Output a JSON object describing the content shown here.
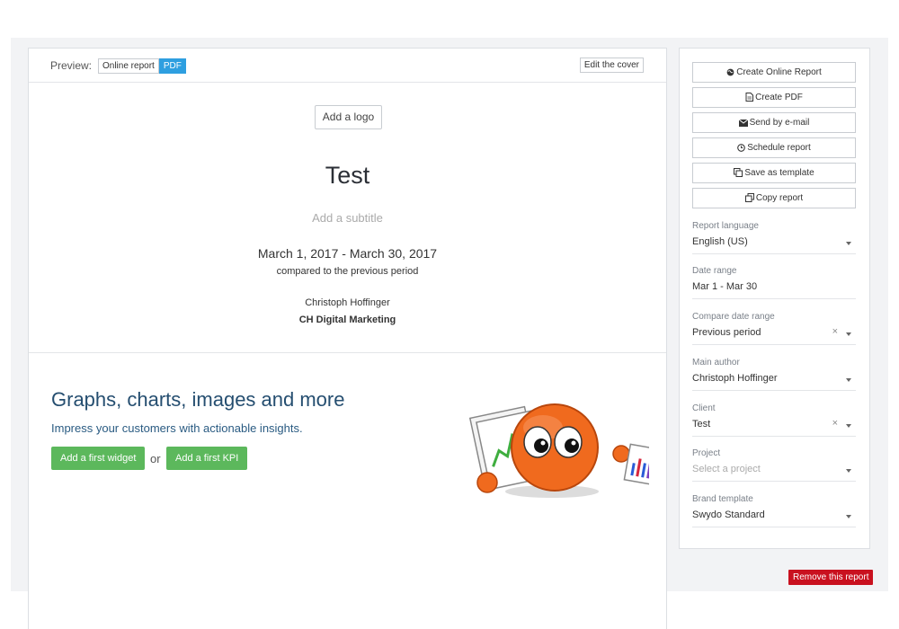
{
  "preview": {
    "label": "Preview:",
    "tabs": [
      {
        "label": "Online report",
        "active": false
      },
      {
        "label": "PDF",
        "active": true
      }
    ],
    "edit_cover": "Edit the cover"
  },
  "cover": {
    "add_logo": "Add a logo",
    "title": "Test",
    "subtitle_placeholder": "Add a subtitle",
    "date_range": "March 1, 2017 - March 30, 2017",
    "compared": "compared to the previous period",
    "author": "Christoph Hoffinger",
    "company": "CH Digital Marketing"
  },
  "promo": {
    "title": "Graphs, charts, images and more",
    "subtitle": "Impress your customers with actionable insights.",
    "widget_button": "Add a first widget",
    "or": "or",
    "kpi_button": "Add a first KPI"
  },
  "actions": [
    {
      "label": "Create Online Report",
      "icon": "globe-icon"
    },
    {
      "label": "Create PDF",
      "icon": "file-icon"
    },
    {
      "label": "Send by e-mail",
      "icon": "envelope-icon"
    },
    {
      "label": "Schedule report",
      "icon": "clock-icon"
    },
    {
      "label": "Save as template",
      "icon": "copy-icon"
    },
    {
      "label": "Copy report",
      "icon": "duplicate-icon"
    }
  ],
  "fields": {
    "report_language": {
      "label": "Report language",
      "value": "English (US)"
    },
    "date_range": {
      "label": "Date range",
      "value": "Mar 1 - Mar 30"
    },
    "compare_range": {
      "label": "Compare date range",
      "value": "Previous period"
    },
    "main_author": {
      "label": "Main author",
      "value": "Christoph Hoffinger"
    },
    "client": {
      "label": "Client",
      "value": "Test"
    },
    "project": {
      "label": "Project",
      "placeholder": "Select a project"
    },
    "brand_template": {
      "label": "Brand template",
      "value": "Swydo Standard"
    }
  },
  "clear_symbol": "×",
  "remove_button": "Remove this report",
  "colors": {
    "accent_blue": "#2e9fe0",
    "green": "#5cb85c",
    "danger": "#c9111f",
    "mascot_orange": "#f06a1e"
  }
}
